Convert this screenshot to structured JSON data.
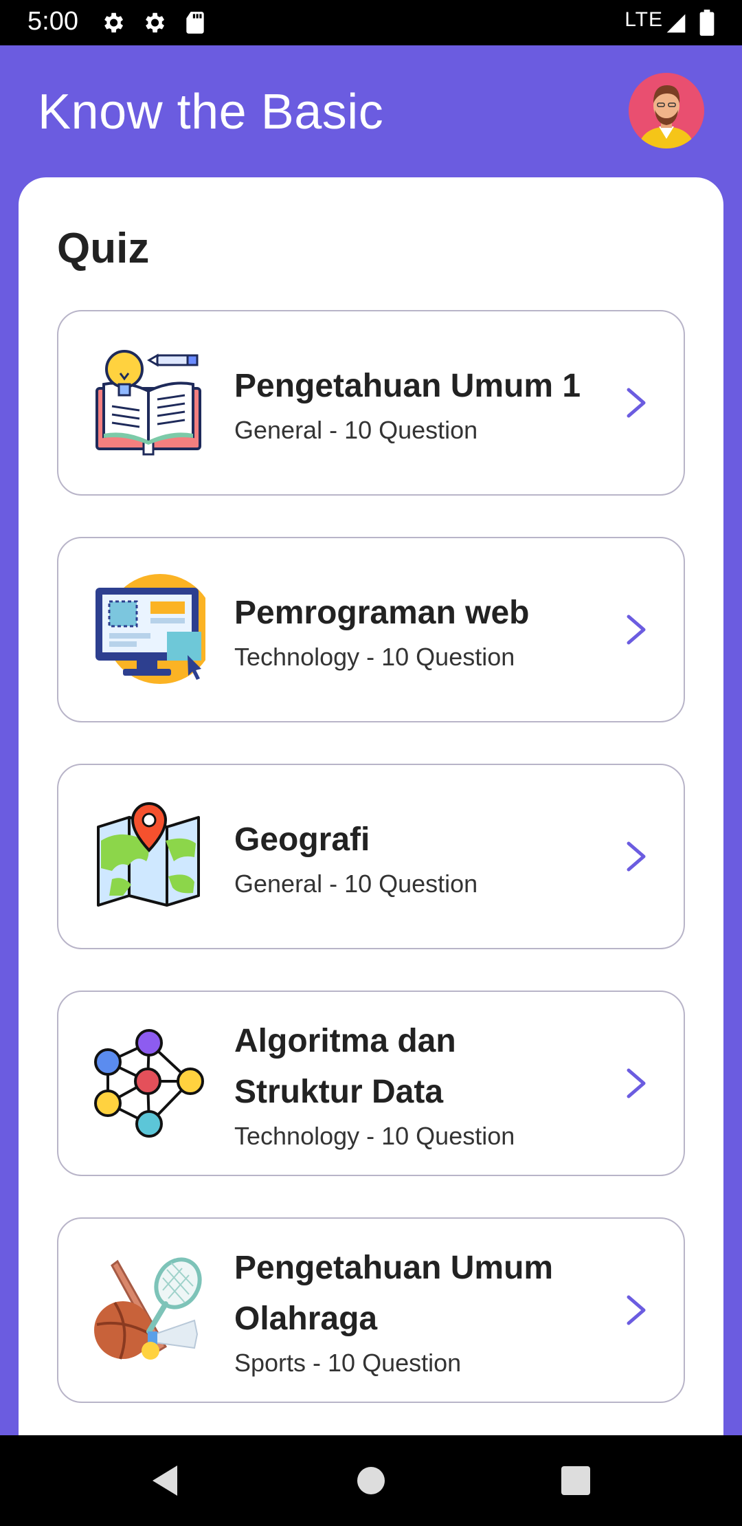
{
  "status_bar": {
    "time": "5:00",
    "network": "LTE"
  },
  "header": {
    "title": "Know the Basic"
  },
  "section": {
    "title": "Quiz"
  },
  "quizzes": [
    {
      "title": "Pengetahuan Umum 1",
      "subtitle": "General - 10 Question",
      "icon": "open-book-icon"
    },
    {
      "title": "Pemrograman web",
      "subtitle": "Technology - 10 Question",
      "icon": "web-monitor-icon"
    },
    {
      "title": "Geografi",
      "subtitle": "General - 10 Question",
      "icon": "map-icon"
    },
    {
      "title": "Algoritma dan Struktur Data",
      "subtitle": "Technology - 10 Question",
      "icon": "network-graph-icon"
    },
    {
      "title": "Pengetahuan Umum Olahraga",
      "subtitle": "Sports - 10 Question",
      "icon": "sports-equipment-icon"
    }
  ],
  "colors": {
    "primary": "#6b5ce0",
    "chevron": "#6b5ce0",
    "card_border": "#b8b4c8"
  }
}
